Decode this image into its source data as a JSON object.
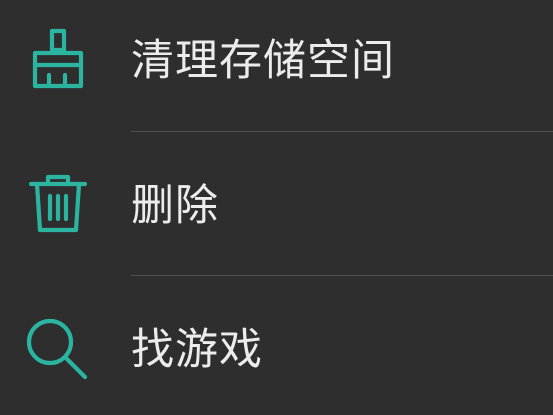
{
  "theme": {
    "background": "#2e2e2e",
    "accent": "#2bb5a0",
    "text": "#ececec",
    "divider": "#525252"
  },
  "menu": {
    "items": [
      {
        "label": "清理存储空间",
        "icon": "broom-icon"
      },
      {
        "label": "删除",
        "icon": "trash-icon"
      },
      {
        "label": "找游戏",
        "icon": "search-icon"
      }
    ]
  }
}
